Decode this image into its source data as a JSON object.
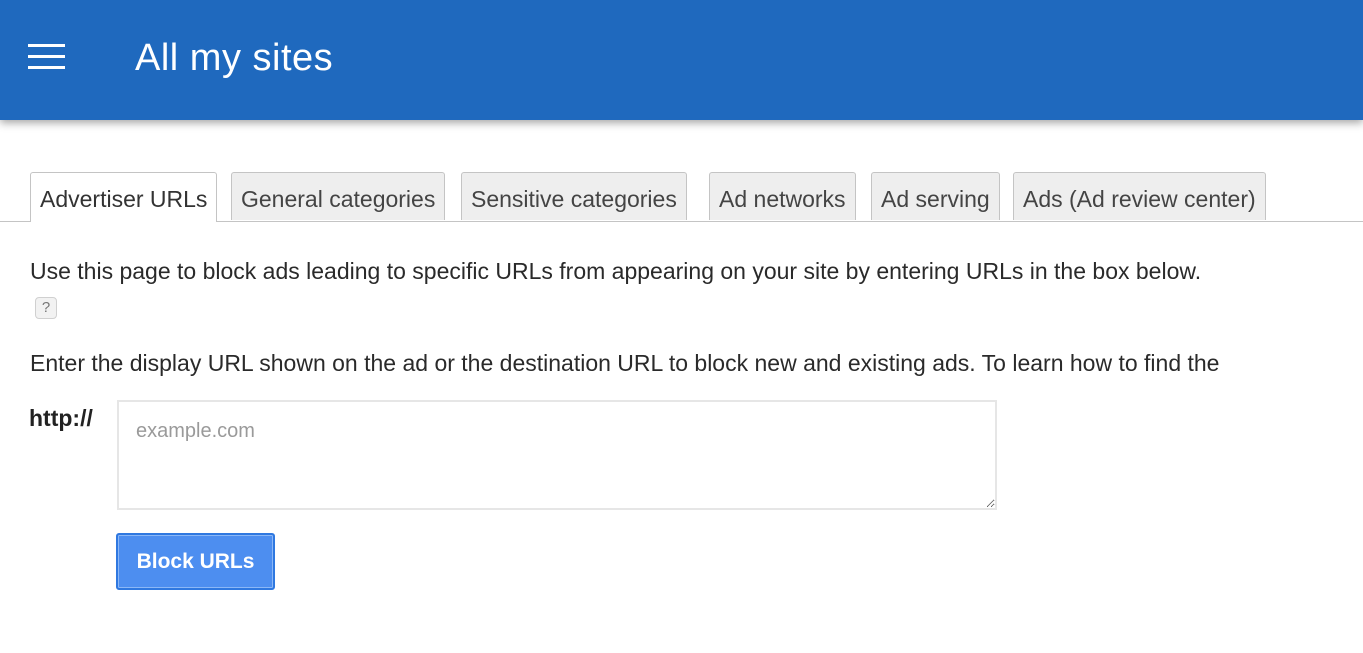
{
  "header": {
    "menu_icon": "hamburger-menu-icon",
    "title": "All my sites",
    "background_color": "#1f69be"
  },
  "tabs": [
    {
      "label": "Advertiser URLs",
      "active": true
    },
    {
      "label": "General categories",
      "active": false
    },
    {
      "label": "Sensitive categories",
      "active": false
    },
    {
      "label": "Ad networks",
      "active": false
    },
    {
      "label": "Ad serving",
      "active": false
    },
    {
      "label": "Ads (Ad review center)",
      "active": false
    }
  ],
  "content": {
    "description": "Use this page to block ads leading to specific URLs from appearing on your site by entering URLs in the box below.",
    "help_icon": "?",
    "instruction": "Enter the display URL shown on the ad or the destination URL to block new and existing ads. To learn how to find the",
    "url_prefix_label": "http://",
    "url_input": {
      "value": "",
      "placeholder": "example.com"
    },
    "block_button_label": "Block URLs",
    "button_color": "#4d8ef0"
  }
}
